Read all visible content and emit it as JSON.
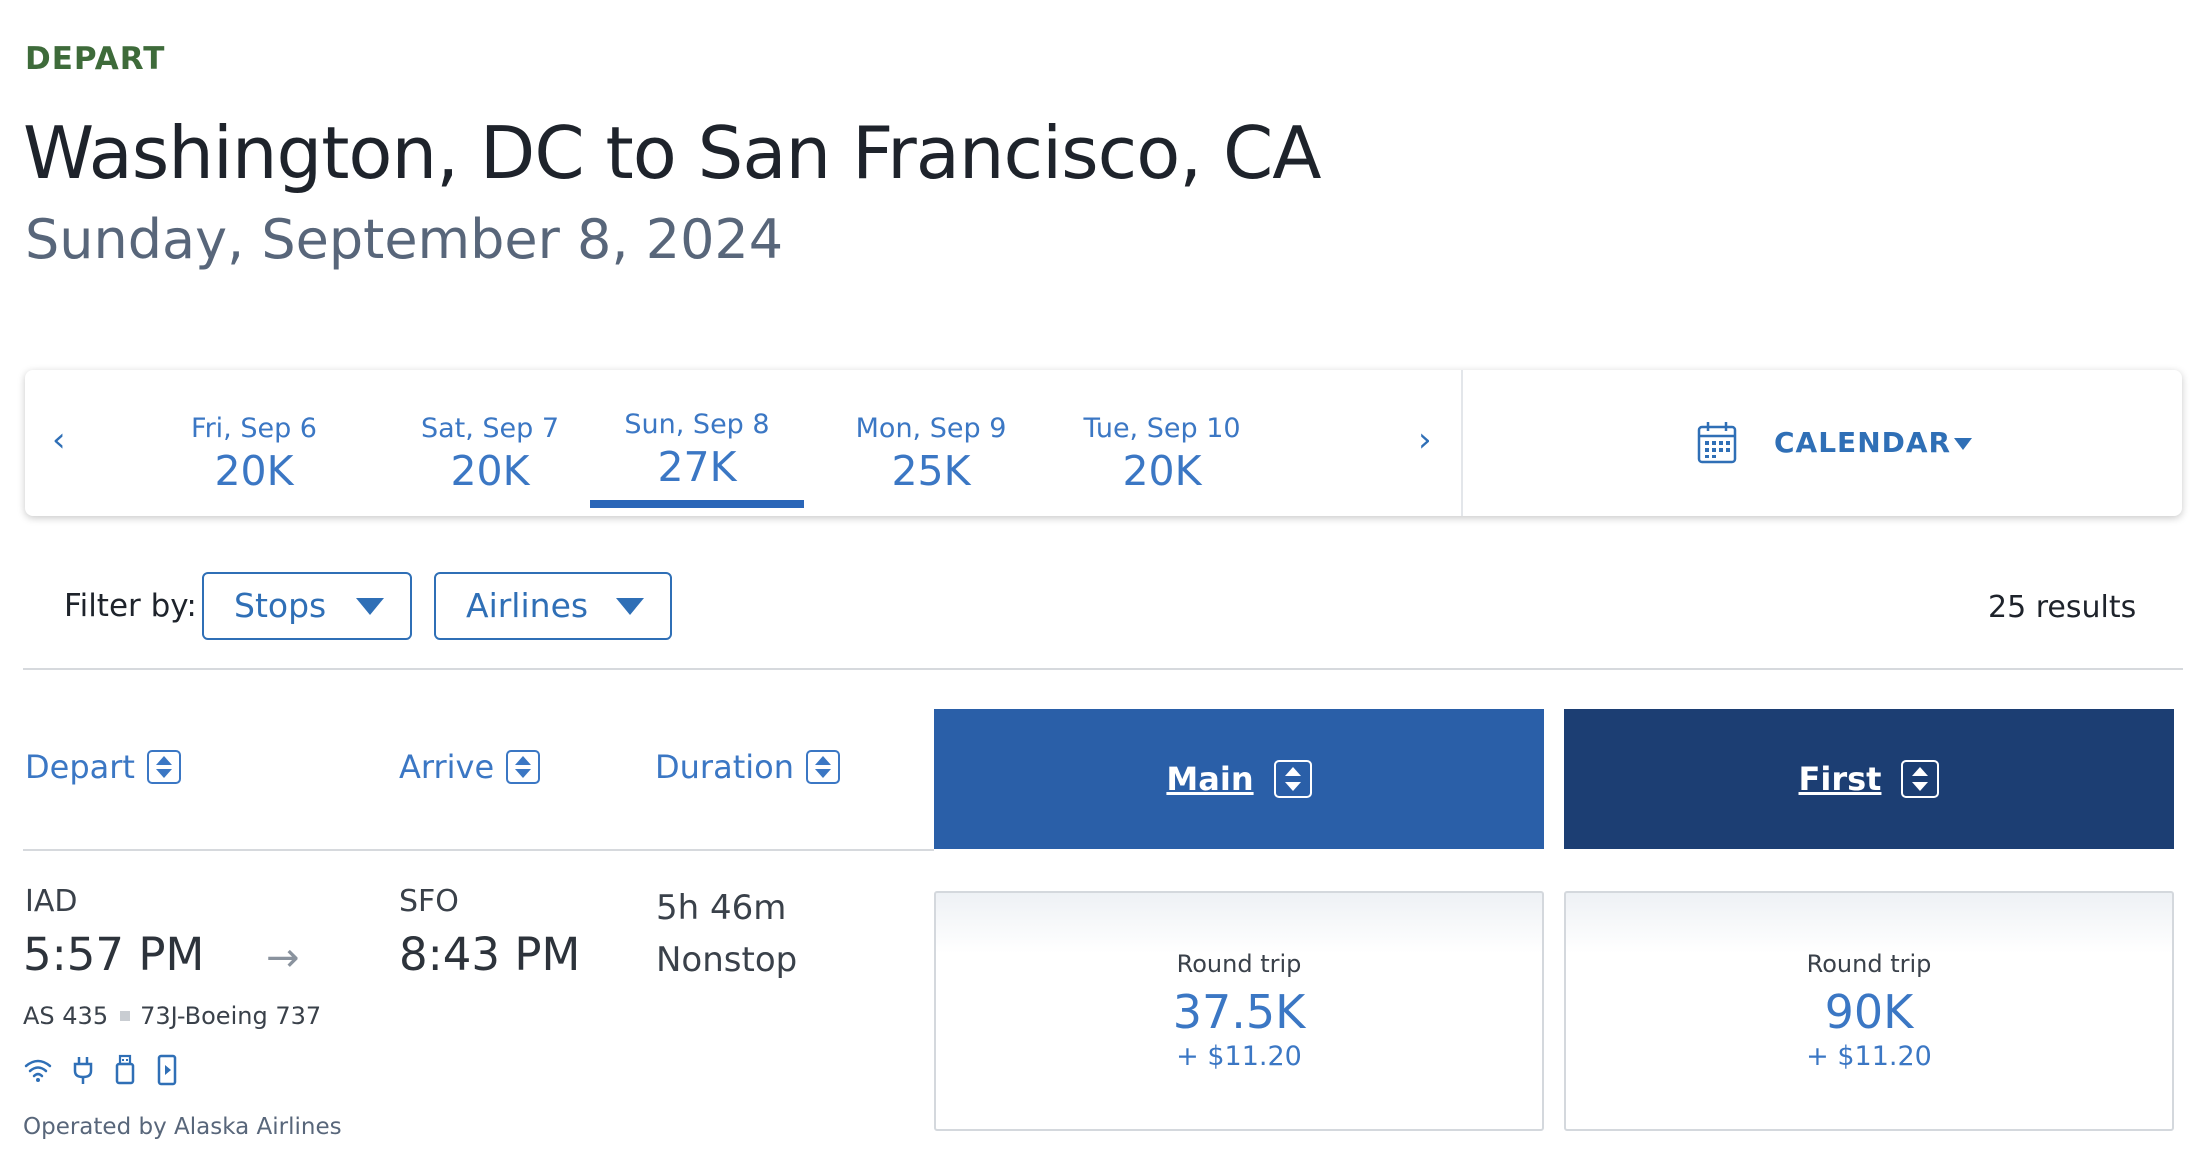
{
  "header": {
    "section_label": "DEPART",
    "route_title": "Washington, DC to San Francisco, CA",
    "date": "Sunday, September 8, 2024"
  },
  "date_selector": {
    "prev_icon": "chevron-left-icon",
    "next_icon": "chevron-right-icon",
    "prev_glyph": "‹",
    "next_glyph": "›",
    "dates": [
      {
        "label": "Fri, Sep 6",
        "price": "20K",
        "selected": false
      },
      {
        "label": "Sat, Sep 7",
        "price": "20K",
        "selected": false
      },
      {
        "label": "Sun, Sep 8",
        "price": "27K",
        "selected": true
      },
      {
        "label": "Mon, Sep 9",
        "price": "25K",
        "selected": false
      },
      {
        "label": "Tue, Sep 10",
        "price": "20K",
        "selected": false
      }
    ],
    "calendar_label": "CALENDAR",
    "calendar_icon": "calendar-icon"
  },
  "filters": {
    "label": "Filter by:",
    "stops": "Stops",
    "airlines": "Airlines",
    "results": "25 results"
  },
  "columns": {
    "depart": "Depart",
    "arrive": "Arrive",
    "duration": "Duration",
    "main": "Main",
    "first": "First"
  },
  "flight": {
    "origin": "IAD",
    "depart_time": "5:57 PM",
    "destination": "SFO",
    "arrive_time": "8:43 PM",
    "arrow": "→",
    "duration": "5h 46m",
    "stops": "Nonstop",
    "flight_number": "AS 435",
    "aircraft": "73J-Boeing 737",
    "amenities": [
      "wifi-icon",
      "power-outlet-icon",
      "usb-icon",
      "streaming-device-icon"
    ],
    "operated_by": "Operated by Alaska Airlines",
    "fares": {
      "main": {
        "type": "Round trip",
        "miles": "37.5K",
        "fee": "+ $11.20"
      },
      "first": {
        "type": "Round trip",
        "miles": "90K",
        "fee": "+ $11.20"
      }
    }
  },
  "colors": {
    "accent": "#3b77c4",
    "main_header": "#2a5fa8",
    "first_header": "#1c3e73",
    "depart_label": "#3e6b3a"
  }
}
